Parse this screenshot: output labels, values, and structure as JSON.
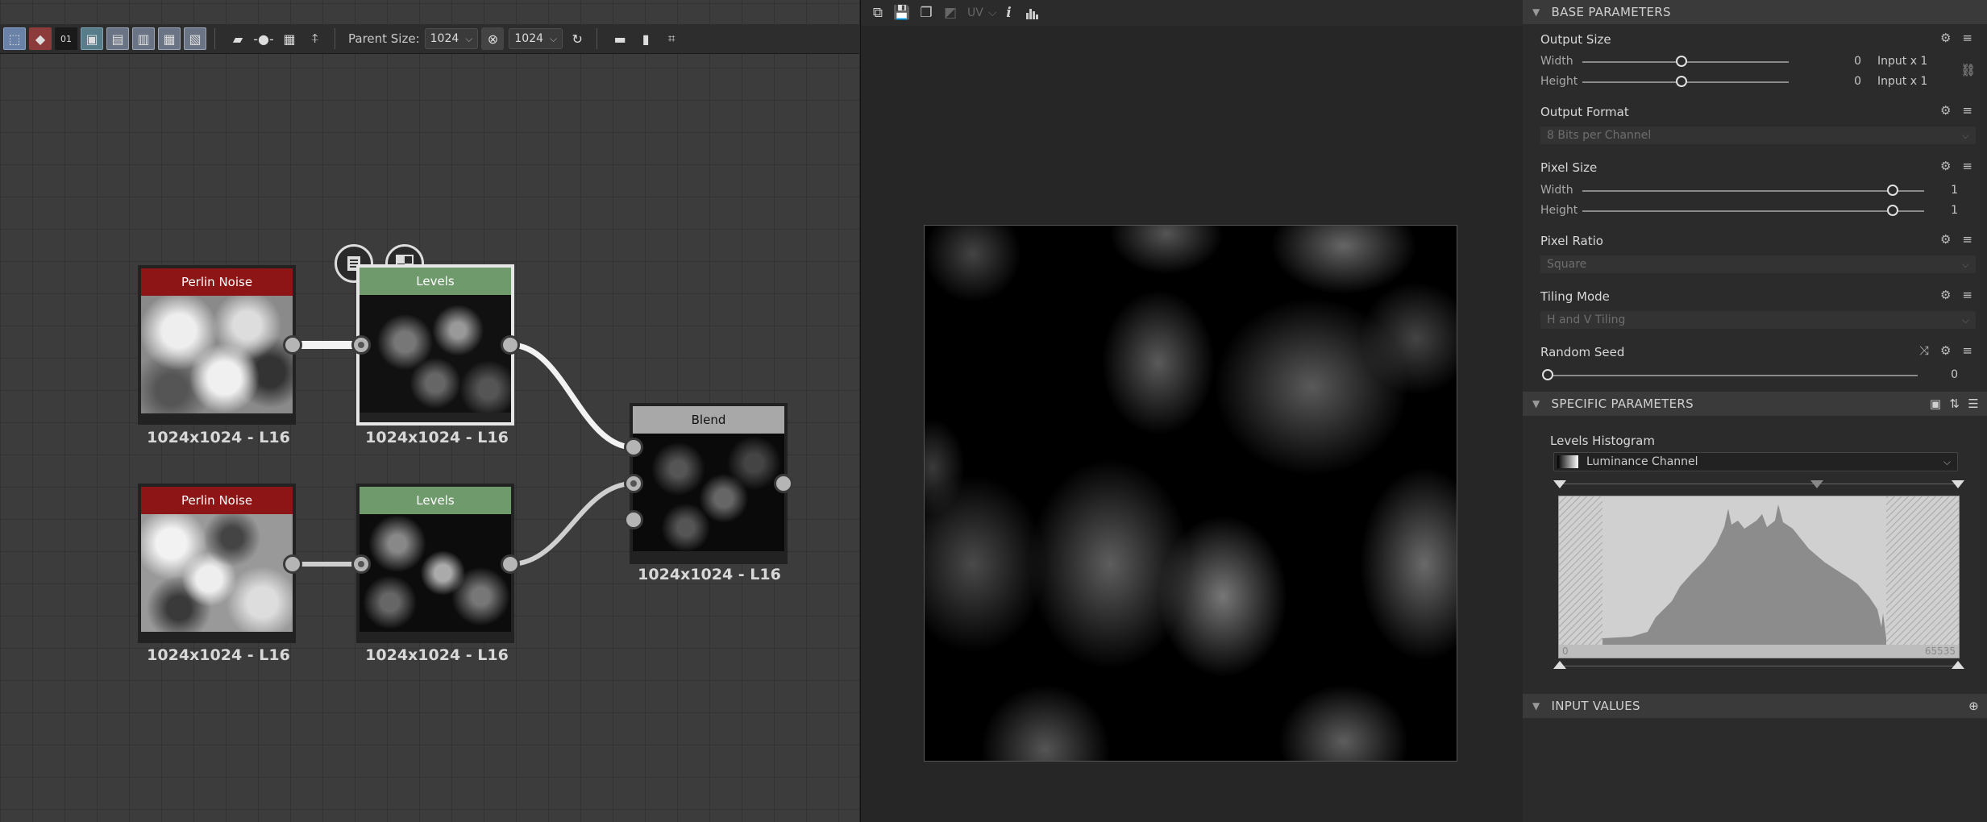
{
  "graph": {
    "toolbar": {
      "parent_size_label": "Parent Size:",
      "width_value": "1024",
      "height_value": "1024",
      "counter_icon_text": "01"
    },
    "nodes": [
      {
        "title": "Perlin Noise",
        "caption": "1024x1024 - L16"
      },
      {
        "title": "Levels",
        "caption": "1024x1024 - L16"
      },
      {
        "title": "Perlin Noise",
        "caption": "1024x1024 - L16"
      },
      {
        "title": "Levels",
        "caption": "1024x1024 - L16"
      },
      {
        "title": "Blend",
        "caption": "1024x1024 - L16"
      }
    ]
  },
  "viewer": {
    "toolbar": {
      "uv_label": "UV"
    }
  },
  "properties": {
    "base_section": "BASE PARAMETERS",
    "output_size": {
      "title": "Output Size",
      "width_label": "Width",
      "width_value": "0",
      "width_suffix": "Input x 1",
      "width_fraction": 0.5,
      "height_label": "Height",
      "height_value": "0",
      "height_suffix": "Input x 1",
      "height_fraction": 0.5
    },
    "output_format": {
      "title": "Output Format",
      "value": "8 Bits per Channel"
    },
    "pixel_size": {
      "title": "Pixel Size",
      "width_label": "Width",
      "width_value": "1",
      "width_fraction": 1.0,
      "height_label": "Height",
      "height_value": "1",
      "height_fraction": 1.0
    },
    "pixel_ratio": {
      "title": "Pixel Ratio",
      "value": "Square"
    },
    "tiling_mode": {
      "title": "Tiling Mode",
      "value": "H and V Tiling"
    },
    "random_seed": {
      "title": "Random Seed",
      "value": "0",
      "fraction": 0.0
    },
    "specific_section": "SPECIFIC PARAMETERS",
    "levels_histogram": {
      "title": "Levels Histogram",
      "channel": "Luminance Channel",
      "min_label": "0",
      "max_label": "65535"
    },
    "input_section": "INPUT VALUES"
  },
  "colors": {
    "node_red": "#8d1515",
    "node_green": "#6e9a6c",
    "node_grey": "#a8a8a8",
    "selection_blue": "#6b82a8"
  }
}
